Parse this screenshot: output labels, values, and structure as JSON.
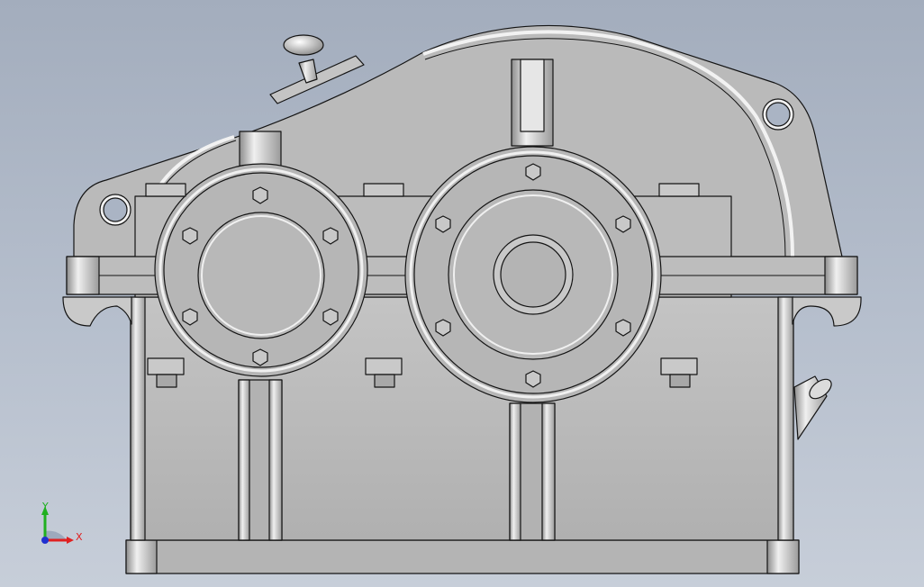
{
  "viewport": {
    "background_top": "#a3adbd",
    "background_bottom": "#c7ced9",
    "model_fill": "#b9b9b9",
    "model_edge": "#141414",
    "highlight": "#f2f2f2"
  },
  "model": {
    "name": "",
    "components": [
      "cover",
      "housing",
      "base-plate",
      "shaft-bearing-cap-left",
      "shaft-bearing-cap-right",
      "flange-bolts",
      "lifting-lug-left",
      "lifting-lug-right",
      "breather-vent",
      "inspection-cover",
      "oil-dipstick",
      "housing-ribs"
    ]
  },
  "triad": {
    "x_label": "X",
    "y_label": "Y",
    "x_color": "#e02020",
    "y_color": "#20b020",
    "z_color": "#2030d0"
  }
}
